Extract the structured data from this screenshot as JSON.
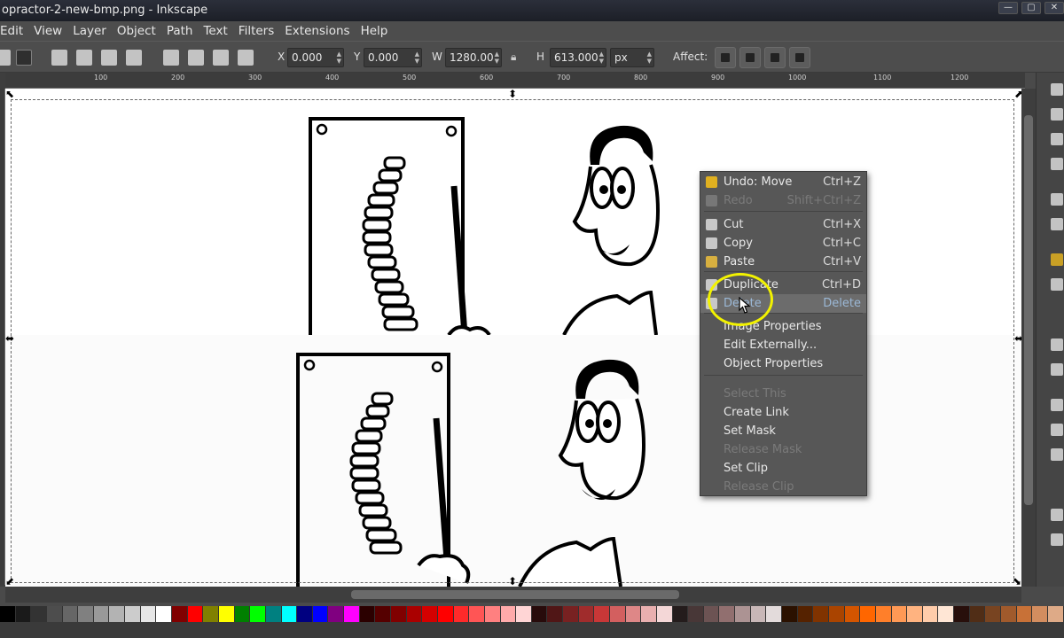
{
  "window": {
    "title": "opractor-2-new-bmp.png - Inkscape",
    "controls": [
      "—",
      "▢",
      "✕"
    ]
  },
  "menu": [
    "Edit",
    "View",
    "Layer",
    "Object",
    "Path",
    "Text",
    "Filters",
    "Extensions",
    "Help"
  ],
  "toolbar": {
    "x_label": "X",
    "x_value": "0.000",
    "y_label": "Y",
    "y_value": "0.000",
    "w_label": "W",
    "w_value": "1280.00",
    "h_label": "H",
    "h_value": "613.000",
    "unit": "px",
    "affect_label": "Affect:"
  },
  "ruler": {
    "labels": [
      "100",
      "200",
      "300",
      "400",
      "500",
      "600",
      "700",
      "800",
      "900",
      "1000",
      "1100",
      "1200"
    ]
  },
  "context_menu": {
    "items": [
      {
        "label": "Undo: Move",
        "accel": "Ctrl+Z",
        "icon": "undo-icon",
        "state": "normal"
      },
      {
        "label": "Redo",
        "accel": "Shift+Ctrl+Z",
        "icon": "redo-icon",
        "state": "disabled"
      },
      {
        "label": "Cut",
        "accel": "Ctrl+X",
        "icon": "scissors-icon",
        "state": "normal"
      },
      {
        "label": "Copy",
        "accel": "Ctrl+C",
        "icon": "copy-icon",
        "state": "normal"
      },
      {
        "label": "Paste",
        "accel": "Ctrl+V",
        "icon": "paste-icon",
        "state": "normal"
      },
      {
        "label": "Duplicate",
        "accel": "Ctrl+D",
        "icon": "duplicate-icon",
        "state": "normal"
      },
      {
        "label": "Delete",
        "accel": "Delete",
        "icon": "delete-icon",
        "state": "highlighted"
      },
      {
        "label": "Image Properties",
        "accel": "",
        "icon": "",
        "state": "normal"
      },
      {
        "label": "Edit Externally...",
        "accel": "",
        "icon": "",
        "state": "normal"
      },
      {
        "label": "Object Properties",
        "accel": "",
        "icon": "",
        "state": "normal"
      },
      {
        "label": "Select This",
        "accel": "",
        "icon": "",
        "state": "disabled"
      },
      {
        "label": "Create Link",
        "accel": "",
        "icon": "",
        "state": "normal"
      },
      {
        "label": "Set Mask",
        "accel": "",
        "icon": "",
        "state": "normal"
      },
      {
        "label": "Release Mask",
        "accel": "",
        "icon": "",
        "state": "disabled"
      },
      {
        "label": "Set Clip",
        "accel": "",
        "icon": "",
        "state": "normal"
      },
      {
        "label": "Release Clip",
        "accel": "",
        "icon": "",
        "state": "disabled"
      }
    ]
  },
  "palette": [
    "#000000",
    "#1a1a1a",
    "#333333",
    "#4d4d4d",
    "#666666",
    "#808080",
    "#999999",
    "#b3b3b3",
    "#cccccc",
    "#e6e6e6",
    "#ffffff",
    "#800000",
    "#ff0000",
    "#808000",
    "#ffff00",
    "#008000",
    "#00ff00",
    "#008080",
    "#00ffff",
    "#000080",
    "#0000ff",
    "#800080",
    "#ff00ff",
    "#2b0000",
    "#550000",
    "#800000",
    "#aa0000",
    "#d40000",
    "#ff0000",
    "#ff2a2a",
    "#ff5555",
    "#ff8080",
    "#ffaaaa",
    "#ffd5d5",
    "#280b0b",
    "#501616",
    "#782121",
    "#a02c2c",
    "#c83737",
    "#d35f5f",
    "#de8787",
    "#e9afaf",
    "#f4d7d7",
    "#241c1c",
    "#483737",
    "#6c5353",
    "#916f6f",
    "#ac9393",
    "#c8b7b7",
    "#e3dbdb",
    "#2b1100",
    "#552200",
    "#803300",
    "#aa4400",
    "#d45500",
    "#ff6600",
    "#ff7f2a",
    "#ff9955",
    "#ffb380",
    "#ffccaa",
    "#ffe6d5",
    "#280f0b",
    "#502d16",
    "#784421",
    "#a05a2c",
    "#c87137",
    "#d38d5f",
    "#deaa87"
  ],
  "colors": {
    "highlight_text": "#9bb8d6",
    "cursor_ring": "#f2f200"
  }
}
